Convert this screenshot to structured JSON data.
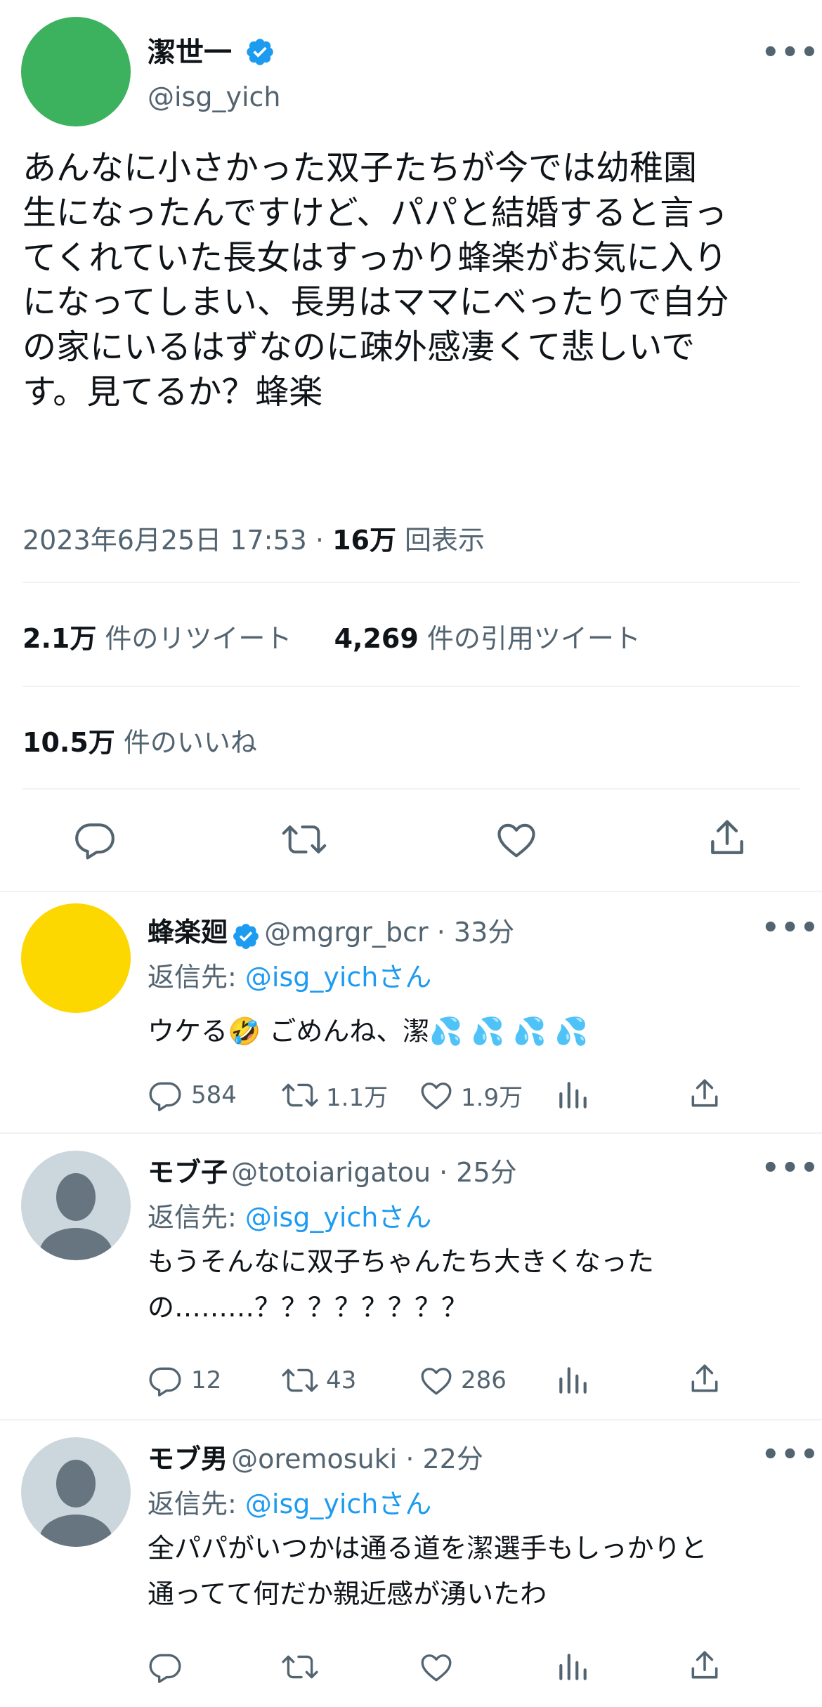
{
  "main_tweet": {
    "display_name": "潔世一",
    "handle": "@isg_yich",
    "text_lines": [
      "あんなに小さかった双子たちが今では幼稚園",
      "生になったんですけど、パパと結婚すると言っ",
      "てくれていた長女はすっかり蜂楽がお気に入り",
      "になってしまい、長男はママにべったりで自分",
      "の家にいるはずなのに疎外感凄くて悲しいで",
      "す。見てるか？蜂楽"
    ],
    "timestamp": "2023年6月25日 17:53 · ",
    "views_count": "16万",
    "views_label": " 回表示",
    "retweets_count": "2.1万",
    "retweets_label": " 件のリツイート",
    "quotes_count": "4,269",
    "quotes_label": " 件の引用ツイート",
    "likes_count": "10.5万",
    "likes_label": " 件のいいね",
    "avatar_color": "#3cb15e"
  },
  "replies": [
    {
      "display_name": "蜂楽廻",
      "handle": "@mgrgr_bcr · 33分",
      "reply_prefix": "返信先: ",
      "reply_target": "@isg_yichさん",
      "text_lines": [
        "ウケる🤣 ごめんね、潔💦 💦 💦 💦"
      ],
      "replies": "584",
      "retweets": "1.1万",
      "likes": "1.9万",
      "avatar_color": "#fcd700"
    },
    {
      "display_name": "モブ子",
      "handle": "@totoiarigatou · 25分",
      "reply_prefix": "返信先: ",
      "reply_target": "@isg_yichさん",
      "text_lines": [
        "もうそんなに双子ちゃんたち大きくなった",
        "の………？？？？？？？？"
      ],
      "replies": "12",
      "retweets": "43",
      "likes": "286",
      "avatar_color": "#ccd6dd"
    },
    {
      "display_name": "モブ男",
      "handle": "@oremosuki · 22分",
      "reply_prefix": "返信先: ",
      "reply_target": "@isg_yichさん",
      "text_lines": [
        "全パパがいつかは通る道を潔選手もしっかりと",
        "通ってて何だか親近感が湧いたわ"
      ],
      "replies": "",
      "retweets": "",
      "likes": "",
      "avatar_color": "#ccd6dd"
    }
  ],
  "colors": {
    "accent": "#1d9bf0",
    "secondary_text": "#536471",
    "divider": "#eff3f4"
  },
  "icons": [
    "verified-badge-icon",
    "more-icon",
    "reply-icon",
    "retweet-icon",
    "like-icon",
    "share-icon",
    "analytics-icon",
    "default-avatar-icon"
  ]
}
